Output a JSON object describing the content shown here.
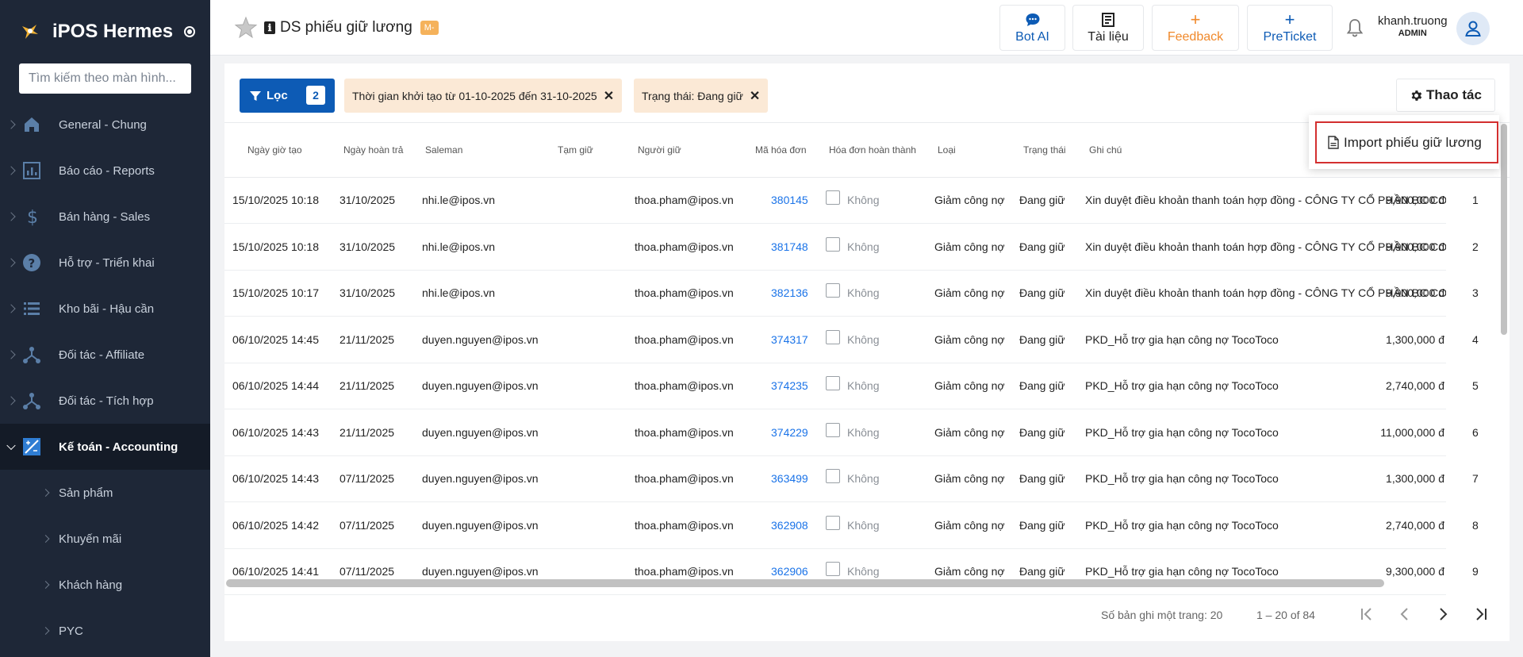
{
  "sidebar": {
    "brand": "iPOS Hermes",
    "search_placeholder": "Tìm kiếm theo màn hình...",
    "menu": [
      {
        "label": "General - Chung",
        "icon": "home-icon"
      },
      {
        "label": "Báo cáo - Reports",
        "icon": "report-chart-icon"
      },
      {
        "label": "Bán hàng - Sales",
        "icon": "dollar-icon"
      },
      {
        "label": "Hỗ trợ - Triển khai",
        "icon": "help-icon"
      },
      {
        "label": "Kho bãi - Hậu cần",
        "icon": "list-icon"
      },
      {
        "label": "Đối tác - Affiliate",
        "icon": "network-icon"
      },
      {
        "label": "Đối tác - Tích hợp",
        "icon": "network-icon"
      },
      {
        "label": "Kế toán - Accounting",
        "icon": "accounting-icon",
        "active": true
      }
    ],
    "submenu": [
      "Sản phẩm",
      "Khuyến mãi",
      "Khách hàng",
      "PYC"
    ]
  },
  "header": {
    "title": "DS phiếu giữ lương",
    "badge": "M-",
    "buttons": [
      {
        "label": "Bot AI",
        "icon": "chat-icon",
        "color": "#0d5bb5"
      },
      {
        "label": "Tài liệu",
        "icon": "book-icon",
        "color": "#222222"
      },
      {
        "label": "Feedback",
        "icon": "plus-icon",
        "color": "#f0892b"
      },
      {
        "label": "PreTicket",
        "icon": "plus-icon",
        "color": "#0d5bb5"
      }
    ],
    "user": {
      "name": "khanh.truong",
      "role": "ADMIN"
    }
  },
  "filters": {
    "filter_label": "Lọc",
    "filter_count": "2",
    "chips": [
      "Thời gian khởi tạo từ 01-10-2025 đến 31-10-2025",
      "Trạng thái: Đang giữ"
    ],
    "actions_label": "Thao tác",
    "dropdown_item": "Import phiếu giữ lương"
  },
  "table": {
    "columns": [
      "Ngày giờ tạo",
      "Ngày hoàn trả",
      "Saleman",
      "Tạm giữ",
      "Người giữ",
      "Mã hóa đơn",
      "Hóa đơn hoàn thành",
      "Loại",
      "Trạng thái",
      "Ghi chú"
    ],
    "rows": [
      {
        "created": "15/10/2025 10:18",
        "returned": "31/10/2025",
        "saleman": "nhi.le@ipos.vn",
        "amount": "9,900,000 đ",
        "holder": "thoa.pham@ipos.vn",
        "invoice": "380145",
        "done": "Không",
        "type": "Giảm công nợ",
        "status": "Đang giữ",
        "note": "Xin duyệt điều khoản thanh toán hợp đồng - CÔNG TY CỔ PHẦN BC CO",
        "idx": "1"
      },
      {
        "created": "15/10/2025 10:18",
        "returned": "31/10/2025",
        "saleman": "nhi.le@ipos.vn",
        "amount": "9,900,000 đ",
        "holder": "thoa.pham@ipos.vn",
        "invoice": "381748",
        "done": "Không",
        "type": "Giảm công nợ",
        "status": "Đang giữ",
        "note": "Xin duyệt điều khoản thanh toán hợp đồng - CÔNG TY CỔ PHẦN BC CO",
        "idx": "2"
      },
      {
        "created": "15/10/2025 10:17",
        "returned": "31/10/2025",
        "saleman": "nhi.le@ipos.vn",
        "amount": "9,900,000 đ",
        "holder": "thoa.pham@ipos.vn",
        "invoice": "382136",
        "done": "Không",
        "type": "Giảm công nợ",
        "status": "Đang giữ",
        "note": "Xin duyệt điều khoản thanh toán hợp đồng - CÔNG TY CỔ PHẦN BC CO",
        "idx": "3"
      },
      {
        "created": "06/10/2025 14:45",
        "returned": "21/11/2025",
        "saleman": "duyen.nguyen@ipos.vn",
        "amount": "1,300,000 đ",
        "holder": "thoa.pham@ipos.vn",
        "invoice": "374317",
        "done": "Không",
        "type": "Giảm công nợ",
        "status": "Đang giữ",
        "note": "PKD_Hỗ trợ gia hạn công nợ TocoToco",
        "idx": "4"
      },
      {
        "created": "06/10/2025 14:44",
        "returned": "21/11/2025",
        "saleman": "duyen.nguyen@ipos.vn",
        "amount": "2,740,000 đ",
        "holder": "thoa.pham@ipos.vn",
        "invoice": "374235",
        "done": "Không",
        "type": "Giảm công nợ",
        "status": "Đang giữ",
        "note": "PKD_Hỗ trợ gia hạn công nợ TocoToco",
        "idx": "5"
      },
      {
        "created": "06/10/2025 14:43",
        "returned": "21/11/2025",
        "saleman": "duyen.nguyen@ipos.vn",
        "amount": "11,000,000 đ",
        "holder": "thoa.pham@ipos.vn",
        "invoice": "374229",
        "done": "Không",
        "type": "Giảm công nợ",
        "status": "Đang giữ",
        "note": "PKD_Hỗ trợ gia hạn công nợ TocoToco",
        "idx": "6"
      },
      {
        "created": "06/10/2025 14:43",
        "returned": "07/11/2025",
        "saleman": "duyen.nguyen@ipos.vn",
        "amount": "1,300,000 đ",
        "holder": "thoa.pham@ipos.vn",
        "invoice": "363499",
        "done": "Không",
        "type": "Giảm công nợ",
        "status": "Đang giữ",
        "note": "PKD_Hỗ trợ gia hạn công nợ TocoToco",
        "idx": "7"
      },
      {
        "created": "06/10/2025 14:42",
        "returned": "07/11/2025",
        "saleman": "duyen.nguyen@ipos.vn",
        "amount": "2,740,000 đ",
        "holder": "thoa.pham@ipos.vn",
        "invoice": "362908",
        "done": "Không",
        "type": "Giảm công nợ",
        "status": "Đang giữ",
        "note": "PKD_Hỗ trợ gia hạn công nợ TocoToco",
        "idx": "8"
      },
      {
        "created": "06/10/2025 14:41",
        "returned": "07/11/2025",
        "saleman": "duyen.nguyen@ipos.vn",
        "amount": "9,300,000 đ",
        "holder": "thoa.pham@ipos.vn",
        "invoice": "362906",
        "done": "Không",
        "type": "Giảm công nợ",
        "status": "Đang giữ",
        "note": "PKD_Hỗ trợ gia hạn công nợ TocoToco",
        "idx": "9"
      }
    ]
  },
  "pagination": {
    "per_page_label": "Số bản ghi một trang: 20",
    "range": "1 – 20 of 84"
  }
}
